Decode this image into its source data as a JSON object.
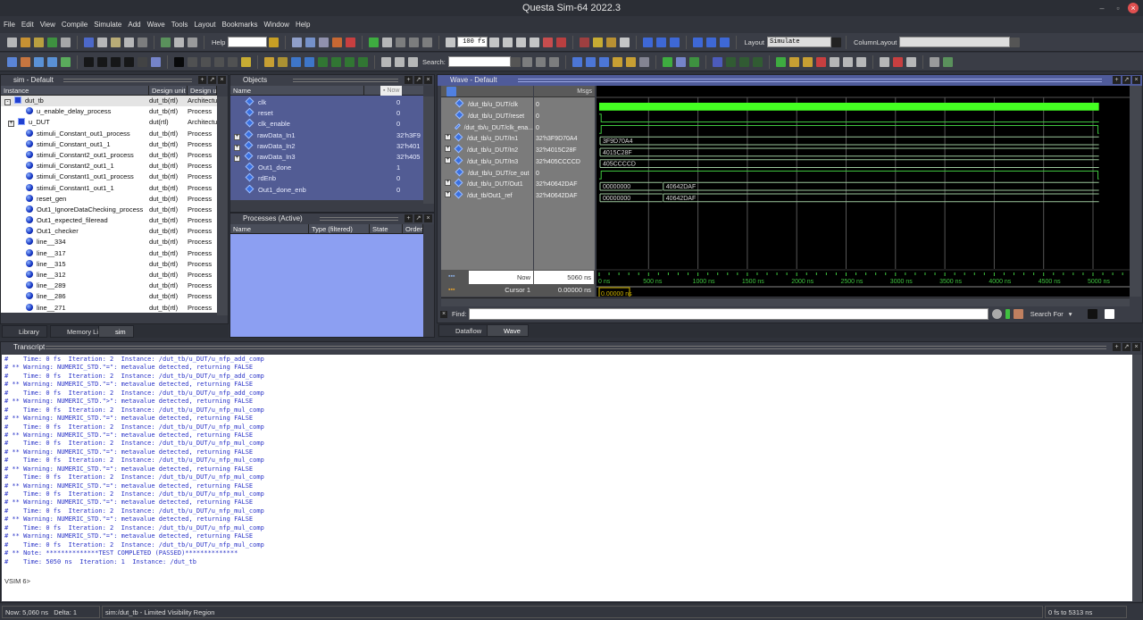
{
  "window": {
    "title": "Questa Sim-64 2022.3"
  },
  "menu": [
    "File",
    "Edit",
    "View",
    "Compile",
    "Simulate",
    "Add",
    "Wave",
    "Tools",
    "Layout",
    "Bookmarks",
    "Window",
    "Help"
  ],
  "toolbar": {
    "help_label": "Help",
    "help_value": "",
    "time_step": "100 fs",
    "layout_label": "Layout",
    "layout_value": "Simulate",
    "column_layout_label": "ColumnLayout",
    "column_layout_value": "",
    "search_label": "Search:",
    "search_value": ""
  },
  "sim_panel": {
    "title": "sim - Default",
    "columns": [
      "Instance",
      "Design unit",
      "Design unit type"
    ],
    "rows": [
      {
        "name": "dut_tb",
        "unit": "dut_tb(rtl)",
        "type": "Architecture",
        "icon": "architecture",
        "level": 0,
        "expand": "-"
      },
      {
        "name": "u_enable_delay_process",
        "unit": "dut_tb(rtl)",
        "type": "Process",
        "icon": "process",
        "level": 1
      },
      {
        "name": "u_DUT",
        "unit": "dut(rtl)",
        "type": "Architecture",
        "icon": "architecture",
        "level": 1,
        "expand": "+"
      },
      {
        "name": "stimuli_Constant_out1_process",
        "unit": "dut_tb(rtl)",
        "type": "Process",
        "icon": "process",
        "level": 1
      },
      {
        "name": "stimuli_Constant_out1_1",
        "unit": "dut_tb(rtl)",
        "type": "Process",
        "icon": "process",
        "level": 1
      },
      {
        "name": "stimuli_Constant2_out1_process",
        "unit": "dut_tb(rtl)",
        "type": "Process",
        "icon": "process",
        "level": 1
      },
      {
        "name": "stimuli_Constant2_out1_1",
        "unit": "dut_tb(rtl)",
        "type": "Process",
        "icon": "process",
        "level": 1
      },
      {
        "name": "stimuli_Constant1_out1_process",
        "unit": "dut_tb(rtl)",
        "type": "Process",
        "icon": "process",
        "level": 1
      },
      {
        "name": "stimuli_Constant1_out1_1",
        "unit": "dut_tb(rtl)",
        "type": "Process",
        "icon": "process",
        "level": 1
      },
      {
        "name": "reset_gen",
        "unit": "dut_tb(rtl)",
        "type": "Process",
        "icon": "process",
        "level": 1
      },
      {
        "name": "Out1_IgnoreDataChecking_process",
        "unit": "dut_tb(rtl)",
        "type": "Process",
        "icon": "process",
        "level": 1
      },
      {
        "name": "Out1_expected_fileread",
        "unit": "dut_tb(rtl)",
        "type": "Process",
        "icon": "process",
        "level": 1
      },
      {
        "name": "Out1_checker",
        "unit": "dut_tb(rtl)",
        "type": "Process",
        "icon": "process",
        "level": 1
      },
      {
        "name": "line__334",
        "unit": "dut_tb(rtl)",
        "type": "Process",
        "icon": "process",
        "level": 1
      },
      {
        "name": "line__317",
        "unit": "dut_tb(rtl)",
        "type": "Process",
        "icon": "process",
        "level": 1
      },
      {
        "name": "line__315",
        "unit": "dut_tb(rtl)",
        "type": "Process",
        "icon": "process",
        "level": 1
      },
      {
        "name": "line__312",
        "unit": "dut_tb(rtl)",
        "type": "Process",
        "icon": "process",
        "level": 1
      },
      {
        "name": "line__289",
        "unit": "dut_tb(rtl)",
        "type": "Process",
        "icon": "process",
        "level": 1
      },
      {
        "name": "line__286",
        "unit": "dut_tb(rtl)",
        "type": "Process",
        "icon": "process",
        "level": 1
      },
      {
        "name": "line__271",
        "unit": "dut_tb(rtl)",
        "type": "Process",
        "icon": "process",
        "level": 1
      }
    ],
    "tabs": [
      "Library",
      "Memory List",
      "sim"
    ],
    "active_tab": "sim"
  },
  "objects_panel": {
    "title": "Objects",
    "columns": [
      "Name"
    ],
    "now_label": "Now",
    "rows": [
      {
        "name": "clk",
        "value": "0"
      },
      {
        "name": "reset",
        "value": "0"
      },
      {
        "name": "clk_enable",
        "value": "0"
      },
      {
        "name": "rawData_In1",
        "value": "32'h3F9",
        "expand": "+"
      },
      {
        "name": "rawData_In2",
        "value": "32'h401",
        "expand": "+"
      },
      {
        "name": "rawData_In3",
        "value": "32'h405",
        "expand": "+"
      },
      {
        "name": "Out1_done",
        "value": "1"
      },
      {
        "name": "rdEnb",
        "value": "0"
      },
      {
        "name": "Out1_done_enb",
        "value": "0"
      }
    ],
    "background": "#525c94"
  },
  "processes_panel": {
    "title": "Processes (Active)",
    "columns": [
      "Name",
      "Type (filtered)",
      "State",
      "Order"
    ],
    "background": "#8c9ff2"
  },
  "wave_panel": {
    "title": "Wave - Default",
    "msgs_label": "Msgs",
    "signals": [
      {
        "name": "/dut_tb/u_DUT/clk",
        "value": "0",
        "kind": "clock"
      },
      {
        "name": "/dut_tb/u_DUT/reset",
        "value": "0",
        "kind": "bit",
        "transitions": [
          [
            0,
            1
          ],
          [
            20,
            0
          ]
        ]
      },
      {
        "name": "/dut_tb/u_DUT/clk_ena...",
        "value": "0",
        "kind": "bit",
        "transitions": [
          [
            0,
            0
          ],
          [
            20,
            1
          ],
          [
            5050,
            0
          ]
        ]
      },
      {
        "name": "/dut_tb/u_DUT/In1",
        "value": "32'h3F9D70A4",
        "kind": "bus",
        "expand": "+",
        "segments": [
          [
            0,
            "3F9D70A4"
          ]
        ]
      },
      {
        "name": "/dut_tb/u_DUT/In2",
        "value": "32'h4015C28F",
        "kind": "bus",
        "expand": "+",
        "segments": [
          [
            0,
            "4015C28F"
          ]
        ]
      },
      {
        "name": "/dut_tb/u_DUT/In3",
        "value": "32'h405CCCCD",
        "kind": "bus",
        "expand": "+",
        "segments": [
          [
            0,
            "405CCCCD"
          ]
        ]
      },
      {
        "name": "/dut_tb/u_DUT/ce_out",
        "value": "0",
        "kind": "bit",
        "transitions": [
          [
            0,
            0
          ],
          [
            20,
            1
          ],
          [
            5050,
            0
          ]
        ]
      },
      {
        "name": "/dut_tb/u_DUT/Out1",
        "value": "32'h40642DAF",
        "kind": "bus",
        "expand": "+",
        "segments": [
          [
            0,
            "00000000"
          ],
          [
            640,
            "40642DAF"
          ]
        ]
      },
      {
        "name": "/dut_tb/Out1_ref",
        "value": "32'h40642DAF",
        "kind": "bus",
        "expand": "+",
        "segments": [
          [
            0,
            "00000000"
          ],
          [
            640,
            "40642DAF"
          ]
        ]
      }
    ],
    "now_label": "Now",
    "now_value": "5060 ns",
    "cursor_label": "Cursor 1",
    "cursor_value": "0.00000 ns",
    "cursor_time_label": "0.00000 ns",
    "timeline": {
      "unit": "ns",
      "start": 0,
      "end": 5400,
      "sim_end": 5060,
      "major_step": 500,
      "ticks": [
        "0 ns",
        "500 ns",
        "1000 ns",
        "1500 ns",
        "2000 ns",
        "2500 ns",
        "3000 ns",
        "3500 ns",
        "4000 ns",
        "4500 ns",
        "5000 ns"
      ]
    },
    "find_label": "Find:",
    "find_value": "",
    "search_for_label": "Search For",
    "tabs": [
      "Dataflow",
      "Wave"
    ],
    "active_tab": "Wave",
    "colors": {
      "signal": "#3fc43f",
      "clock_fill": "#44ff22",
      "bus": "#9cc79c",
      "canvas": "#000000",
      "names_bg": "#7b7b7b",
      "cursor": "#d4b800"
    }
  },
  "transcript": {
    "title": "Transcript",
    "lines": [
      "#    Time: 0 fs  Iteration: 2  Instance: /dut_tb/u_DUT/u_nfp_add_comp",
      "# ** Warning: NUMERIC_STD.\"=\": metavalue detected, returning FALSE",
      "#    Time: 0 fs  Iteration: 2  Instance: /dut_tb/u_DUT/u_nfp_add_comp",
      "# ** Warning: NUMERIC_STD.\"=\": metavalue detected, returning FALSE",
      "#    Time: 0 fs  Iteration: 2  Instance: /dut_tb/u_DUT/u_nfp_add_comp",
      "# ** Warning: NUMERIC_STD.\">\": metavalue detected, returning FALSE",
      "#    Time: 0 fs  Iteration: 2  Instance: /dut_tb/u_DUT/u_nfp_mul_comp",
      "# ** Warning: NUMERIC_STD.\"=\": metavalue detected, returning FALSE",
      "#    Time: 0 fs  Iteration: 2  Instance: /dut_tb/u_DUT/u_nfp_mul_comp",
      "# ** Warning: NUMERIC_STD.\"=\": metavalue detected, returning FALSE",
      "#    Time: 0 fs  Iteration: 2  Instance: /dut_tb/u_DUT/u_nfp_mul_comp",
      "# ** Warning: NUMERIC_STD.\"=\": metavalue detected, returning FALSE",
      "#    Time: 0 fs  Iteration: 2  Instance: /dut_tb/u_DUT/u_nfp_mul_comp",
      "# ** Warning: NUMERIC_STD.\"=\": metavalue detected, returning FALSE",
      "#    Time: 0 fs  Iteration: 2  Instance: /dut_tb/u_DUT/u_nfp_mul_comp",
      "# ** Warning: NUMERIC_STD.\"=\": metavalue detected, returning FALSE",
      "#    Time: 0 fs  Iteration: 2  Instance: /dut_tb/u_DUT/u_nfp_mul_comp",
      "# ** Warning: NUMERIC_STD.\"=\": metavalue detected, returning FALSE",
      "#    Time: 0 fs  Iteration: 2  Instance: /dut_tb/u_DUT/u_nfp_mul_comp",
      "# ** Warning: NUMERIC_STD.\"=\": metavalue detected, returning FALSE",
      "#    Time: 0 fs  Iteration: 2  Instance: /dut_tb/u_DUT/u_nfp_mul_comp",
      "# ** Warning: NUMERIC_STD.\"=\": metavalue detected, returning FALSE",
      "#    Time: 0 fs  Iteration: 2  Instance: /dut_tb/u_DUT/u_nfp_mul_comp",
      "# ** Note: **************TEST COMPLETED (PASSED)**************",
      "#    Time: 5050 ns  Iteration: 1  Instance: /dut_tb",
      "",
      "VSIM 6>"
    ]
  },
  "status": {
    "now": "Now: 5,060 ns",
    "delta": "Delta: 1",
    "context": "sim:/dut_tb - Limited Visibility Region",
    "range": "0 fs to 5313 ns"
  },
  "toolbar_icons": {
    "row1": [
      [
        "new-file-icon",
        "#ccc"
      ],
      [
        "open-icon",
        "#e0a030"
      ],
      [
        "save-icon",
        "#d0b040"
      ],
      [
        "refresh-icon",
        "#40a040"
      ],
      [
        "print-icon",
        "#bbb"
      ],
      "|",
      [
        "cut-icon",
        "#5070e0"
      ],
      [
        "copy-icon",
        "#ccc"
      ],
      [
        "paste-icon",
        "#d0c080"
      ],
      [
        "undo-icon",
        "#ccc"
      ],
      [
        "redo-icon",
        "#888"
      ],
      "|",
      [
        "compile-icon",
        "#60a060"
      ],
      [
        "find-icon",
        "#ccc"
      ],
      [
        "list-icon",
        "#aaa"
      ],
      "|"
    ],
    "row1b": [
      [
        "help-query-icon",
        "#e0b020"
      ],
      "|",
      [
        "sim-icon",
        "#a0b0e0"
      ],
      [
        "wave-icon",
        "#80a0e0"
      ],
      [
        "memory-icon",
        "#a0a0c0"
      ],
      [
        "break-icon",
        "#e07030"
      ],
      [
        "delete-icon",
        "#e04040"
      ],
      "|",
      [
        "restart-icon",
        "#40c040"
      ],
      [
        "step-icon",
        "#ccc"
      ],
      [
        "up-icon",
        "#888"
      ],
      [
        "back-icon",
        "#888"
      ],
      [
        "forward-icon",
        "#888"
      ],
      "|",
      [
        "run-icon",
        "#ddd"
      ]
    ],
    "row1c": [
      [
        "run-length-icon",
        "#ddd"
      ],
      [
        "continue-icon",
        "#ddd"
      ],
      [
        "run-all-icon",
        "#ddd"
      ],
      [
        "break-sim-icon",
        "#ddd"
      ],
      [
        "stop-icon",
        "#e05050"
      ],
      [
        "stop-sign-icon",
        "#d04040"
      ],
      "|",
      [
        "profile-icon",
        "#b04040"
      ],
      [
        "perf-icon",
        "#e0c030"
      ],
      [
        "mem-profile-icon",
        "#d0a030"
      ],
      [
        "cover-icon",
        "#ddd"
      ],
      "|",
      [
        "step-into-icon",
        "#4070f0"
      ],
      [
        "step-over-icon",
        "#4070f0"
      ],
      [
        "step-out-icon",
        "#4070f0"
      ],
      "|",
      [
        "step-back-icon",
        "#4070f0"
      ],
      [
        "step-back-over-icon",
        "#4070f0"
      ],
      [
        "step-back-out-icon",
        "#4070f0"
      ]
    ],
    "row2": [
      [
        "add-wave-icon",
        "#6090f0"
      ],
      [
        "add-list-icon",
        "#e08040"
      ],
      [
        "add-log-icon",
        "#60a0f0"
      ],
      [
        "add-dataflow-icon",
        "#60a0f0"
      ],
      [
        "add-schematic-icon",
        "#60c060"
      ],
      "|",
      [
        "bit-icon",
        "#111"
      ],
      [
        "zero-icon",
        "#111"
      ],
      [
        "x-icon",
        "#111"
      ],
      [
        "value-icon",
        "#111"
      ],
      [
        "bus-icon",
        "#444"
      ],
      [
        "wrench-icon",
        "#8090e0"
      ],
      "|",
      [
        "black-box-icon",
        "#000"
      ],
      [
        "layers-icon",
        "#555"
      ],
      [
        "grid-icon",
        "#555"
      ],
      [
        "columns-icon",
        "#555"
      ],
      [
        "split-icon",
        "#555"
      ],
      [
        "traffic-light-icon",
        "#e0c030"
      ],
      "|",
      [
        "insert-cursor-icon",
        "#e0b030"
      ],
      [
        "delete-cursor-icon",
        "#c0a030"
      ],
      [
        "prev-edge-icon",
        "#4080e0"
      ],
      [
        "next-edge-icon",
        "#4080e0"
      ],
      [
        "edge1-icon",
        "#308030"
      ],
      [
        "edge2-icon",
        "#308030"
      ],
      [
        "edge3-icon",
        "#308030"
      ],
      [
        "edge4-icon",
        "#308030"
      ],
      "|",
      [
        "expand-icon",
        "#ccc"
      ],
      [
        "collapse-icon",
        "#ccc"
      ],
      [
        "group-icon",
        "#ccc"
      ]
    ],
    "row2b": [
      [
        "search-prev-icon",
        "#888"
      ],
      [
        "search-next-icon",
        "#888"
      ],
      [
        "search-options-icon",
        "#888"
      ],
      "|",
      [
        "zoom-in-icon",
        "#5080f0"
      ],
      [
        "zoom-out-icon",
        "#5080f0"
      ],
      [
        "zoom-full-icon",
        "#5080f0"
      ],
      [
        "zoom-cursor-icon",
        "#e0b030"
      ],
      [
        "zoom-range-icon",
        "#e0b030"
      ],
      [
        "zoom-last-icon",
        "#9090a0"
      ],
      "|",
      [
        "wave-format-icon",
        "#40c040"
      ],
      [
        "wave-format2-icon",
        "#8090e0"
      ],
      [
        "wave-format3-icon",
        "#40a040"
      ],
      "|",
      [
        "wave-sig1-icon",
        "#5060d0"
      ],
      [
        "wave-sig2-icon",
        "#306030"
      ],
      [
        "wave-sig3-icon",
        "#306030"
      ],
      [
        "wave-sig4-icon",
        "#306030"
      ],
      "|",
      [
        "cursor-left-icon",
        "#40c040"
      ],
      [
        "cursor-lock-icon",
        "#e0b030"
      ],
      [
        "cursor-add-icon",
        "#e0b030"
      ],
      [
        "cursor-del-icon",
        "#e04040"
      ],
      [
        "cursor-snap-icon",
        "#ccc"
      ],
      [
        "cursor-x-icon",
        "#ccc"
      ],
      [
        "cursor-y-icon",
        "#ccc"
      ],
      "|",
      [
        "menu-icon",
        "#ccc"
      ],
      [
        "remove-icon",
        "#e04040"
      ],
      [
        "reload-icon",
        "#ccc"
      ],
      "|",
      [
        "layout-icon",
        "#aaa"
      ],
      [
        "window-icon",
        "#60a060"
      ]
    ]
  }
}
